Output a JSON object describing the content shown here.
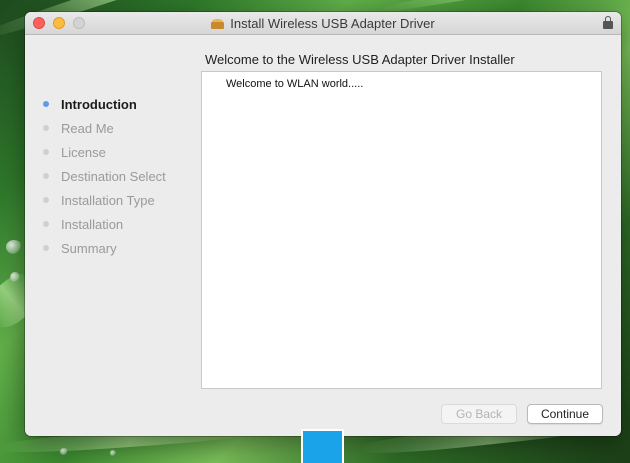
{
  "window": {
    "title": "Install Wireless USB Adapter Driver"
  },
  "heading": "Welcome to the Wireless USB Adapter Driver Installer",
  "sidebar": {
    "steps": [
      {
        "label": "Introduction",
        "active": true
      },
      {
        "label": "Read Me",
        "active": false
      },
      {
        "label": "License",
        "active": false
      },
      {
        "label": "Destination Select",
        "active": false
      },
      {
        "label": "Installation Type",
        "active": false
      },
      {
        "label": "Installation",
        "active": false
      },
      {
        "label": "Summary",
        "active": false
      }
    ]
  },
  "pane": {
    "text": "Welcome to WLAN world....."
  },
  "buttons": {
    "back": {
      "label": "Go Back",
      "enabled": false
    },
    "continue": {
      "label": "Continue",
      "enabled": true
    }
  },
  "icons": {
    "title_icon": "package-icon",
    "lock": "lock-icon"
  },
  "colors": {
    "active_step_dot": "#5d9cec",
    "inactive_step_dot": "#d0d0d0",
    "overlay_square": "#1aa3e8",
    "traffic_close": "#fc605c",
    "traffic_minimize": "#fdbc40"
  }
}
